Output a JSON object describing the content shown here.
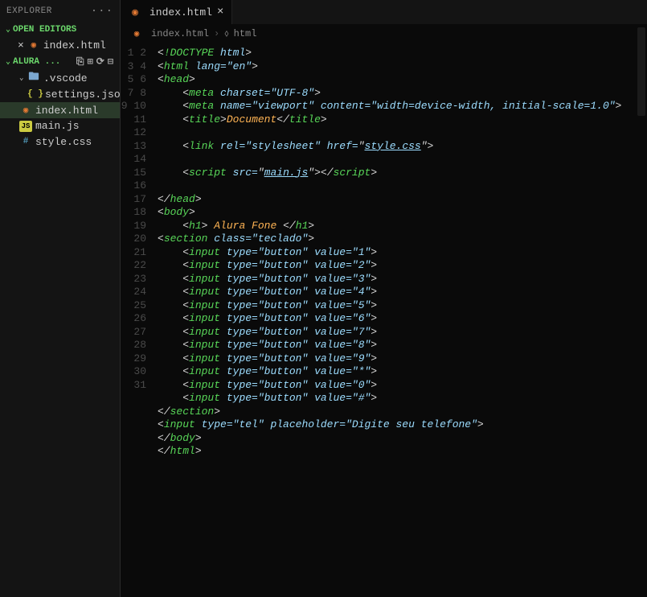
{
  "sidebar": {
    "title": "EXPLORER",
    "sections": {
      "openEditors": {
        "label": "OPEN EDITORS"
      },
      "folder": {
        "label": "ALURA ..."
      }
    },
    "openEditorItems": [
      {
        "name": "index.html",
        "active": false
      }
    ],
    "tree": {
      "vscode_folder": ".vscode",
      "items": [
        {
          "name": "settings.json",
          "type": "json"
        },
        {
          "name": "index.html",
          "type": "html",
          "active": true
        },
        {
          "name": "main.js",
          "type": "js"
        },
        {
          "name": "style.css",
          "type": "css"
        }
      ]
    }
  },
  "tab": {
    "label": "index.html"
  },
  "breadcrumb": {
    "file": "index.html",
    "symbol": "html"
  },
  "lineCount": 31,
  "code": {
    "l1": {
      "pre": "",
      "t": "!DOCTYPE",
      "a": " html"
    },
    "l2": {
      "pre": "",
      "t": "html",
      "a": " lang=",
      "v": "\"en\""
    },
    "l3": {
      "pre": "",
      "t": "head"
    },
    "l4": {
      "pre": "    ",
      "t": "meta",
      "a": " charset=",
      "v": "\"UTF-8\""
    },
    "l5": {
      "pre": "    ",
      "t": "meta",
      "a": " name=",
      "v": "\"viewport\"",
      "a2": " content=",
      "v2": "\"width=device-width, initial-scale=1.0\""
    },
    "l6": {
      "pre": "    ",
      "t": "title",
      "txt": "Document",
      "ct": "title"
    },
    "l8": {
      "pre": "    ",
      "t": "link",
      "a": " rel=",
      "v": "\"stylesheet\"",
      "a2": " href=",
      "v2link": "style.css"
    },
    "l10": {
      "pre": "    ",
      "t": "script",
      "a": " src=",
      "vlink": "main.js",
      "ct": "script"
    },
    "l12": {
      "pre": "",
      "ct": "head"
    },
    "l13": {
      "pre": "",
      "t": "body"
    },
    "l14": {
      "pre": "    ",
      "t": "h1",
      "txt": " Alura Fone ",
      "ct": "h1"
    },
    "l15": {
      "pre": "",
      "t": "section",
      "a": " class=",
      "v": "\"teclado\""
    },
    "inputs": [
      {
        "v": "\"1\""
      },
      {
        "v": "\"2\""
      },
      {
        "v": "\"3\""
      },
      {
        "v": "\"4\""
      },
      {
        "v": "\"5\""
      },
      {
        "v": "\"6\""
      },
      {
        "v": "\"7\""
      },
      {
        "v": "\"8\""
      },
      {
        "v": "\"9\""
      },
      {
        "v": "\"*\""
      },
      {
        "v": "\"0\""
      },
      {
        "v": "\"#\""
      }
    ],
    "input_common": {
      "pre": "    ",
      "t": "input",
      "a": " type=",
      "v": "\"button\"",
      "a2": " value="
    },
    "l28": {
      "pre": "",
      "ct": "section"
    },
    "l29": {
      "pre": "",
      "t": "input",
      "a": " type=",
      "v": "\"tel\"",
      "a2": " placeholder=",
      "v2": "\"Digite seu telefone\""
    },
    "l30": {
      "pre": "",
      "ct": "body"
    },
    "l31": {
      "pre": "",
      "ct": "html"
    }
  }
}
